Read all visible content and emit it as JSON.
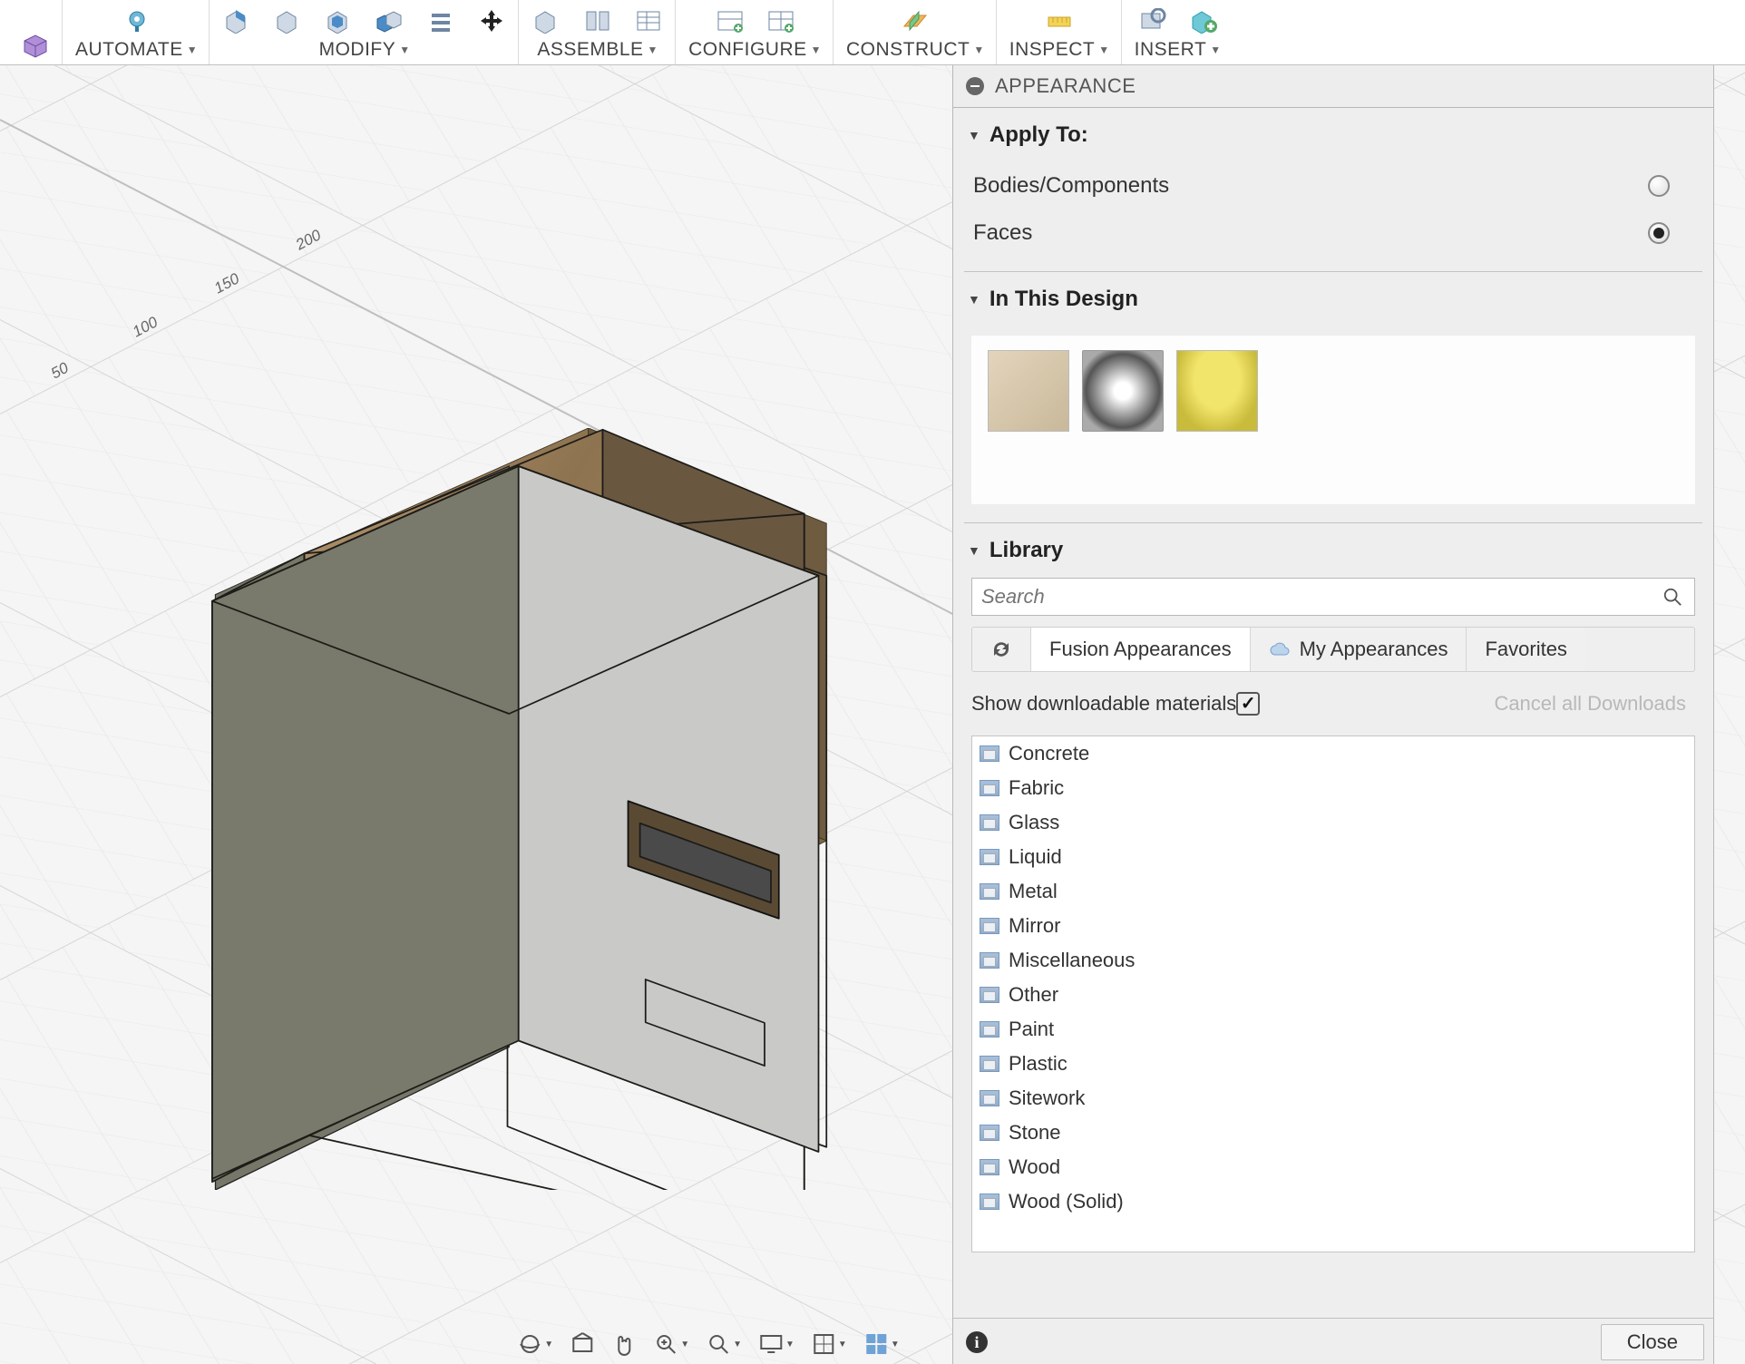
{
  "toolbar": {
    "automate": "AUTOMATE",
    "modify": "MODIFY",
    "assemble": "ASSEMBLE",
    "configure": "CONFIGURE",
    "construct": "CONSTRUCT",
    "inspect": "INSPECT",
    "insert": "INSERT"
  },
  "panel": {
    "title": "APPEARANCE",
    "apply_to": {
      "label": "Apply To:",
      "options": {
        "bodies": "Bodies/Components",
        "faces": "Faces"
      },
      "selected": "faces"
    },
    "in_this_design": {
      "label": "In This Design",
      "items": [
        "oak",
        "steel",
        "yellow-paint"
      ]
    },
    "library": {
      "label": "Library",
      "search_placeholder": "Search",
      "tabs": {
        "fusion": "Fusion Appearances",
        "mine": "My Appearances",
        "favorites": "Favorites"
      },
      "active_tab": "fusion",
      "show_downloadable": "Show downloadable materials",
      "show_downloadable_checked": true,
      "cancel_all": "Cancel all Downloads",
      "categories": [
        "Concrete",
        "Fabric",
        "Glass",
        "Liquid",
        "Metal",
        "Mirror",
        "Miscellaneous",
        "Other",
        "Paint",
        "Plastic",
        "Sitework",
        "Stone",
        "Wood",
        "Wood (Solid)"
      ]
    },
    "footer": {
      "close": "Close"
    }
  },
  "ruler_ticks": [
    "50",
    "100",
    "150",
    "200"
  ]
}
